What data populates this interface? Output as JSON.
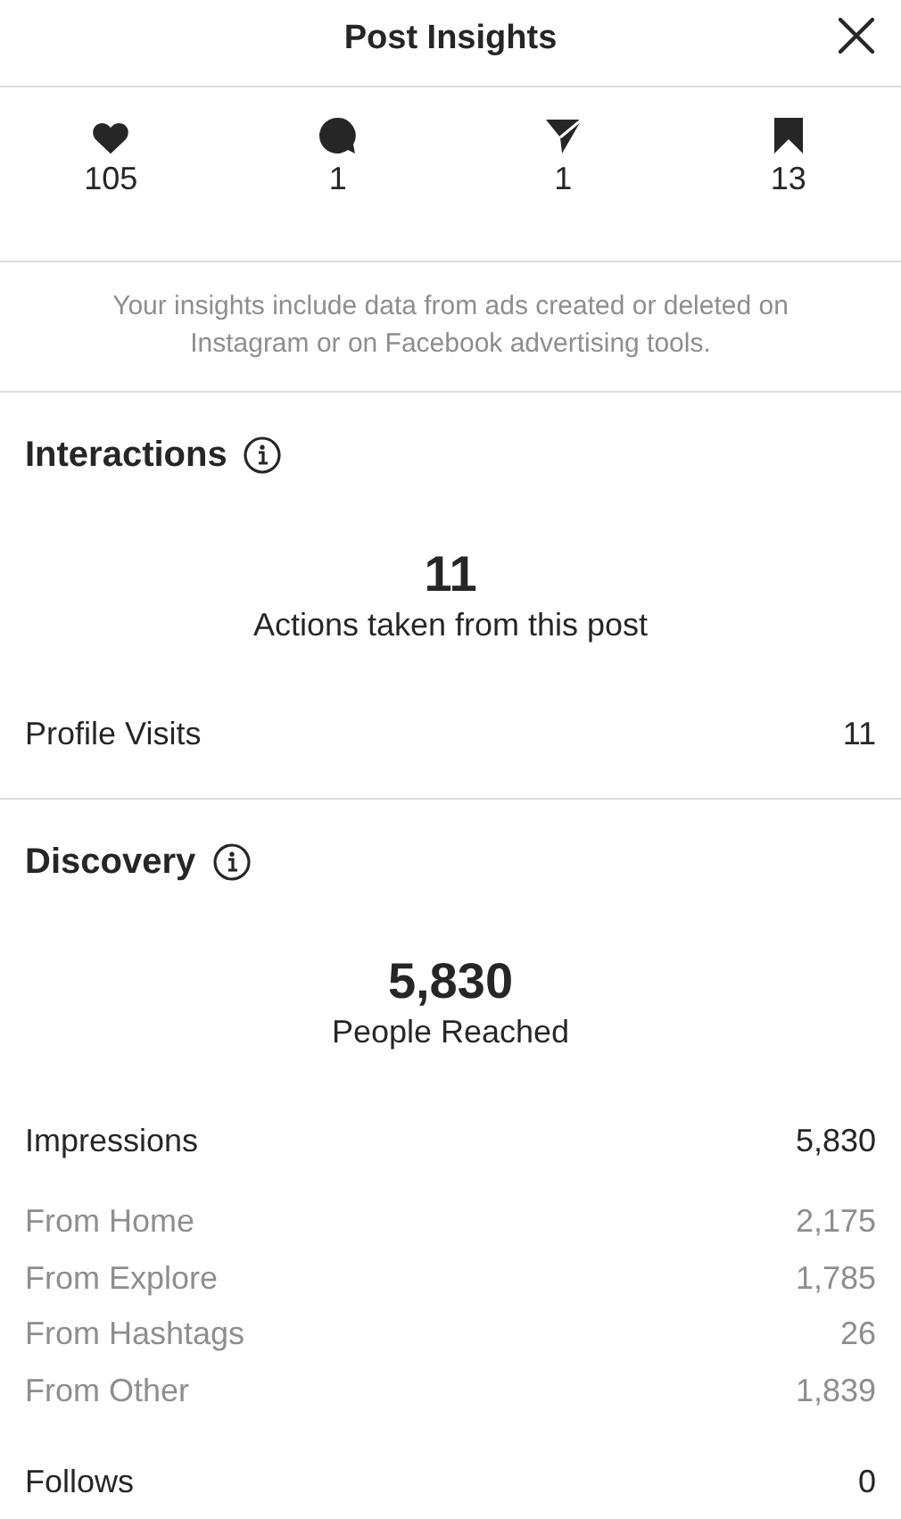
{
  "header": {
    "title": "Post Insights"
  },
  "stats": [
    {
      "kind": "like",
      "value": "105"
    },
    {
      "kind": "comment",
      "value": "1"
    },
    {
      "kind": "share",
      "value": "1"
    },
    {
      "kind": "save",
      "value": "13"
    }
  ],
  "notice": "Your insights include data from ads created or deleted on Instagram or on Facebook advertising tools.",
  "interactions": {
    "title": "Interactions",
    "total": "11",
    "caption": "Actions taken from this post",
    "rows": [
      {
        "kind": "main",
        "label": "Profile Visits",
        "value": "11"
      }
    ]
  },
  "discovery": {
    "title": "Discovery",
    "total": "5,830",
    "caption": "People Reached",
    "rows": [
      {
        "kind": "main",
        "label": "Impressions",
        "value": "5,830"
      },
      {
        "kind": "sub",
        "label": "From Home",
        "value": "2,175"
      },
      {
        "kind": "sub",
        "label": "From Explore",
        "value": "1,785"
      },
      {
        "kind": "sub",
        "label": "From Hashtags",
        "value": "26"
      },
      {
        "kind": "sub",
        "label": "From Other",
        "value": "1,839"
      },
      {
        "kind": "follows",
        "label": "Follows",
        "value": "0"
      }
    ]
  }
}
